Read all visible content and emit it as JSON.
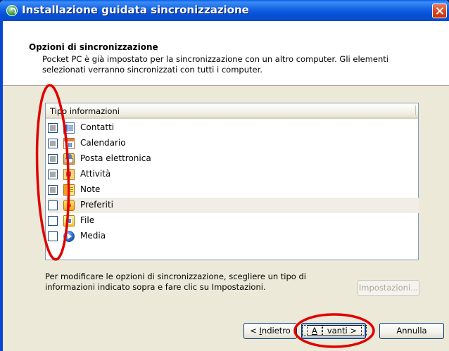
{
  "window": {
    "title": "Installazione guidata sincronizzazione"
  },
  "header": {
    "title": "Opzioni di sincronizzazione",
    "description": "Pocket PC è già impostato per la sincronizzazione con un altro computer. Gli elementi selezionati verranno sincronizzati con tutti i computer."
  },
  "list": {
    "column_header": "Tipo informazioni",
    "items": [
      {
        "label": "Contatti",
        "icon": "contacts-icon",
        "state": "indeterminate",
        "selected": false
      },
      {
        "label": "Calendario",
        "icon": "calendar-icon",
        "state": "indeterminate",
        "selected": false
      },
      {
        "label": "Posta elettronica",
        "icon": "mail-icon",
        "state": "indeterminate",
        "selected": false
      },
      {
        "label": "Attività",
        "icon": "tasks-icon",
        "state": "indeterminate",
        "selected": false
      },
      {
        "label": "Note",
        "icon": "notes-icon",
        "state": "indeterminate",
        "selected": false
      },
      {
        "label": "Preferiti",
        "icon": "favorites-icon",
        "state": "unchecked",
        "selected": true
      },
      {
        "label": "File",
        "icon": "file-icon",
        "state": "unchecked",
        "selected": false
      },
      {
        "label": "Media",
        "icon": "media-icon",
        "state": "unchecked",
        "selected": false
      }
    ]
  },
  "info_text": "Per modificare le opzioni di sincronizzazione, scegliere un tipo di informazioni indicato sopra e fare clic su Impostazioni.",
  "buttons": {
    "settings": "Impostazioni...",
    "back_prefix": "< ",
    "back_access": "I",
    "back_rest": "ndietro",
    "next_access": "A",
    "next_rest": "vanti >",
    "cancel": "Annulla"
  },
  "colors": {
    "titlebar": "#0550d6",
    "annotation": "#e00000",
    "dialog_bg": "#ece9d8"
  }
}
